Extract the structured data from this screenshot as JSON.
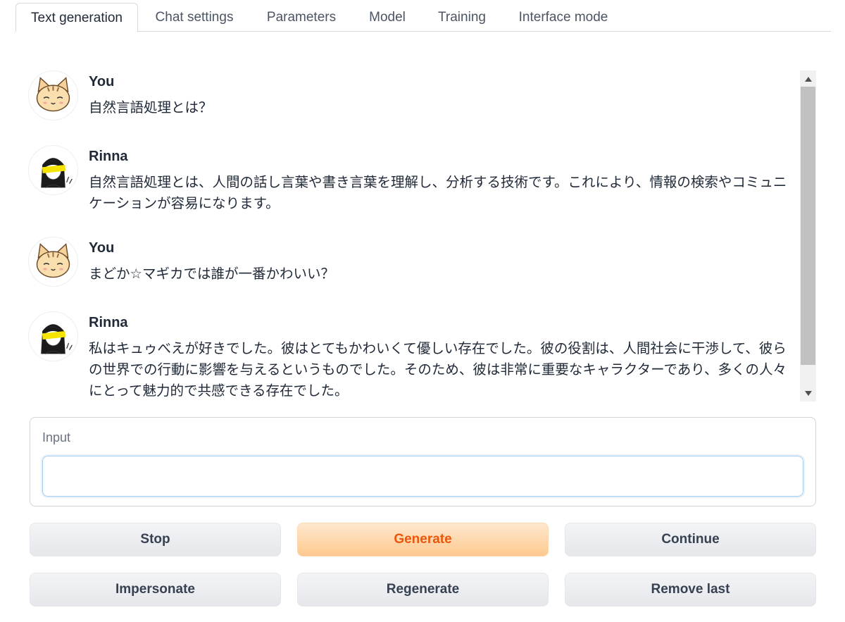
{
  "tabs": [
    {
      "label": "Text generation",
      "active": true
    },
    {
      "label": "Chat settings",
      "active": false
    },
    {
      "label": "Parameters",
      "active": false
    },
    {
      "label": "Model",
      "active": false
    },
    {
      "label": "Training",
      "active": false
    },
    {
      "label": "Interface mode",
      "active": false
    }
  ],
  "chat": {
    "messages": [
      {
        "sender": "You",
        "avatar": "cat-avatar-icon",
        "text": "自然言語処理とは？"
      },
      {
        "sender": "Rinna",
        "avatar": "girl-avatar-icon",
        "text": "自然言語処理とは、人間の話し言葉や書き言葉を理解し、分析する技術です。これにより、情報の検索やコミュニケーションが容易になります。"
      },
      {
        "sender": "You",
        "avatar": "cat-avatar-icon",
        "text": "まどか☆マギカでは誰が一番かわいい？"
      },
      {
        "sender": "Rinna",
        "avatar": "girl-avatar-icon",
        "text": "私はキュゥべえが好きでした。彼はとてもかわいくて優しい存在でした。彼の役割は、人間社会に干渉して、彼らの世界での行動に影響を与えるというものでした。そのため、彼は非常に重要なキャラクターであり、多くの人々にとって魅力的で共感できる存在でした。"
      }
    ]
  },
  "input": {
    "label": "Input",
    "value": "",
    "placeholder": ""
  },
  "buttons": {
    "stop": "Stop",
    "generate": "Generate",
    "continue": "Continue",
    "impersonate": "Impersonate",
    "regenerate": "Regenerate",
    "remove_last": "Remove last"
  },
  "colors": {
    "accent": "#ea580c",
    "primary_button_bg": "#fdc98e",
    "button_bg": "#e5e7eb",
    "border": "#d1d5db"
  }
}
